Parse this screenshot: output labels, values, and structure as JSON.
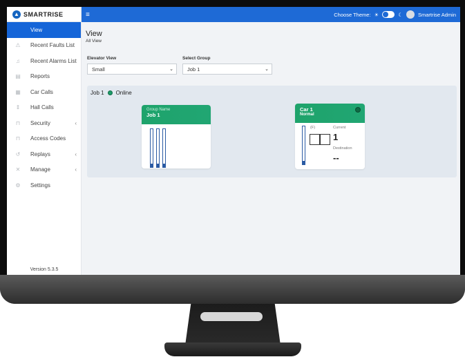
{
  "app": {
    "logo_text": "SMARTRISE",
    "version": "Version 5.3.5"
  },
  "sidebar": {
    "items": [
      {
        "label": "View",
        "icon": "view-icon",
        "active": true
      },
      {
        "label": "Recent Faults List",
        "icon": "warning-icon"
      },
      {
        "label": "Recent Alarms List",
        "icon": "bell-icon"
      },
      {
        "label": "Reports",
        "icon": "document-icon"
      },
      {
        "label": "Car Calls",
        "icon": "car-calls-icon"
      },
      {
        "label": "Hall Calls",
        "icon": "hall-calls-icon"
      },
      {
        "label": "Security",
        "icon": "lock-icon",
        "chevron": true
      },
      {
        "label": "Access Codes",
        "icon": "lock-icon"
      },
      {
        "label": "Replays",
        "icon": "replay-icon",
        "chevron": true
      },
      {
        "label": "Manage",
        "icon": "tools-icon",
        "chevron": true
      },
      {
        "label": "Settings",
        "icon": "gear-icon"
      }
    ],
    "chevron_glyph": "‹"
  },
  "topbar": {
    "menu_glyph": "≡",
    "theme_label": "Choose Theme:",
    "sun_glyph": "☀",
    "moon_glyph": "☾",
    "user_name": "Smartrise Admin"
  },
  "page": {
    "title": "View",
    "breadcrumb": "All View"
  },
  "filters": {
    "elevator_view_label": "Elevator View",
    "elevator_view_value": "Small",
    "select_group_label": "Select Group",
    "select_group_value": "Job 1",
    "arrow_glyph": "⌄"
  },
  "job": {
    "name": "Job 1",
    "status": "Online",
    "group_card": {
      "label": "Group Name",
      "name": "Job 1"
    },
    "car_card": {
      "name": "Car 1",
      "mode": "Normal",
      "floor_label": "(F)",
      "current_label": "Current",
      "current_value": "1",
      "destination_label": "Destination",
      "destination_value": "--"
    }
  },
  "colors": {
    "accent": "#1e6ad6",
    "card_green": "#1ea36b",
    "online": "#1e9c6a"
  }
}
